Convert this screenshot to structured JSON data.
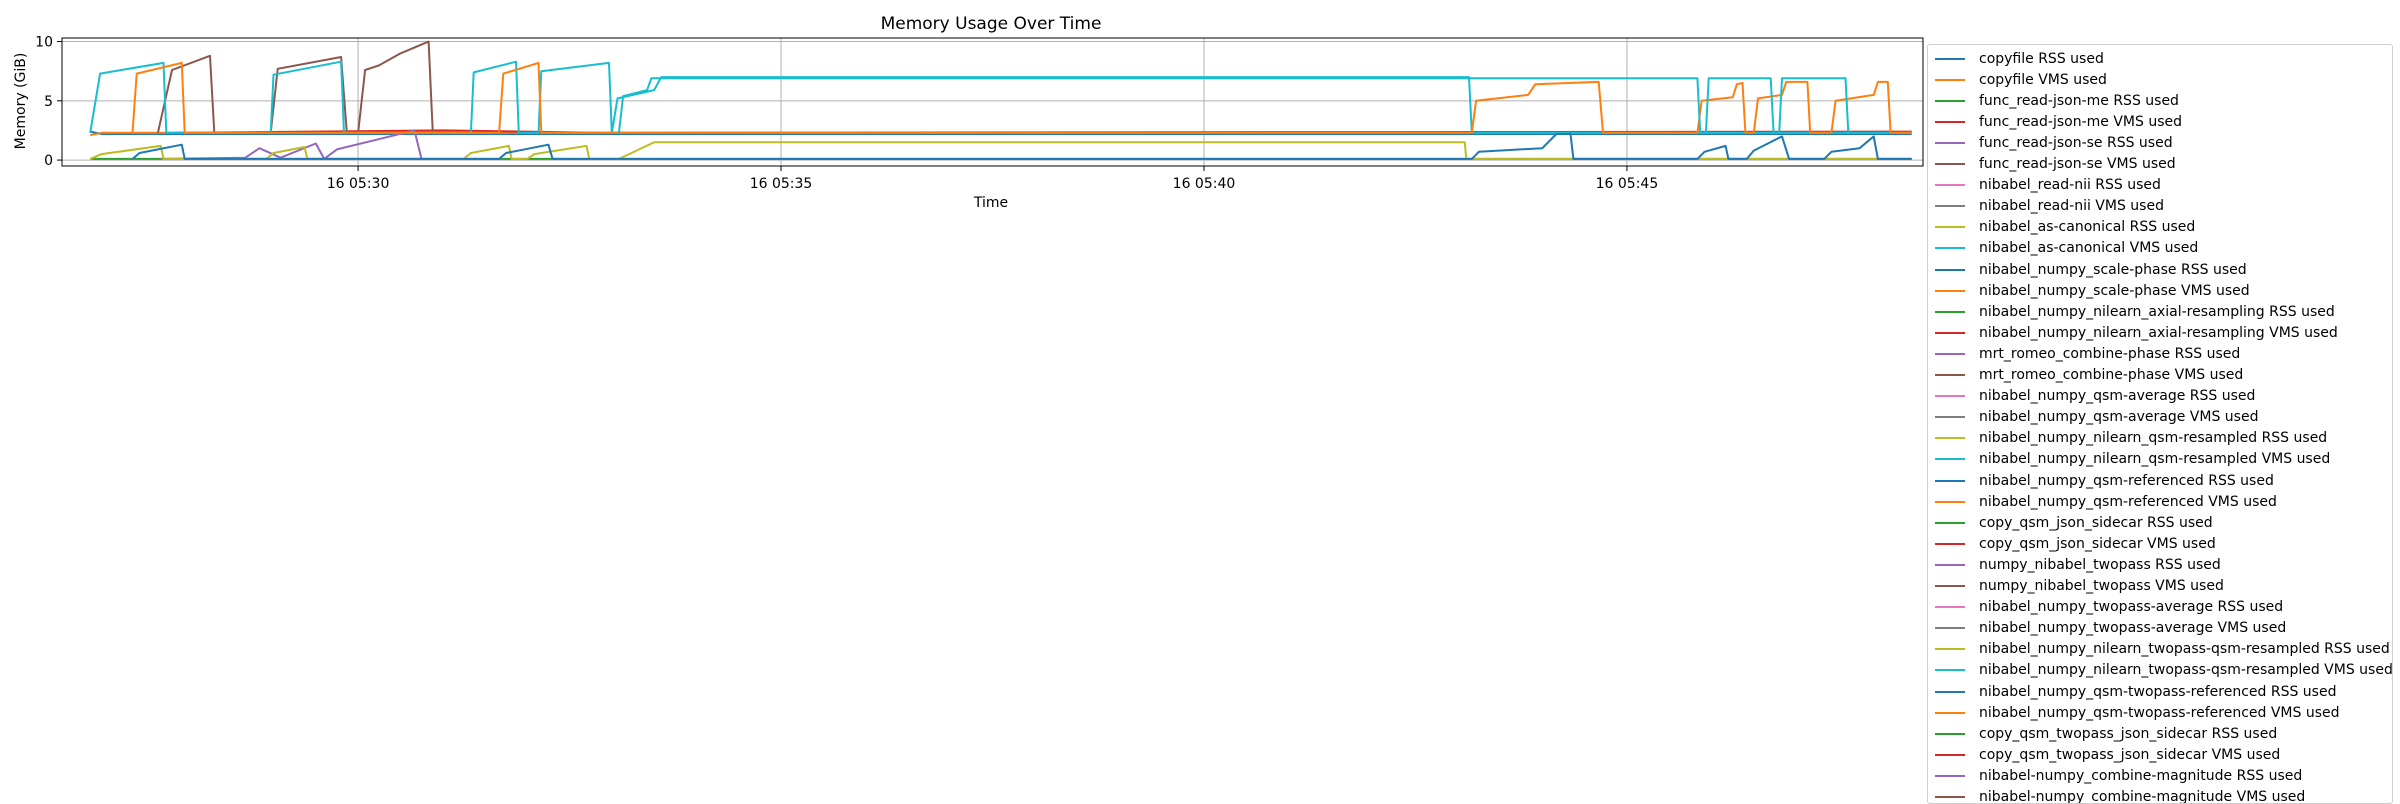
{
  "chart_data": {
    "type": "line",
    "title": "Memory Usage Over Time",
    "xlabel": "Time",
    "ylabel": "Memory (GiB)",
    "x_domain": [
      "16 05:26:30",
      "16 05:48:30"
    ],
    "ylim": [
      -0.5,
      10.3
    ],
    "x_ticks": [
      {
        "t": "16 05:30:00",
        "label": "16 05:30"
      },
      {
        "t": "16 05:35:00",
        "label": "16 05:35"
      },
      {
        "t": "16 05:40:00",
        "label": "16 05:40"
      },
      {
        "t": "16 05:45:00",
        "label": "16 05:45"
      }
    ],
    "y_ticks": [
      0,
      5,
      10
    ],
    "grid": true,
    "legend_position": "outside-right",
    "series": [
      {
        "name": "copyfile RSS used",
        "color": "#1f77b4",
        "points": [
          [
            "16 05:26:50",
            2.4
          ],
          [
            "16 05:26:58",
            2.2
          ],
          [
            "16 05:48:22",
            2.2
          ]
        ]
      },
      {
        "name": "copyfile VMS used",
        "color": "#ff7f0e",
        "points": [
          [
            "16 05:26:50",
            2.1
          ],
          [
            "16 05:26:58",
            2.3
          ],
          [
            "16 05:48:22",
            2.3
          ]
        ]
      },
      {
        "name": "func_read-json-me RSS used",
        "color": "#2ca02c",
        "points": [
          [
            "16 05:26:50",
            0.1
          ],
          [
            "16 05:48:22",
            0.1
          ]
        ]
      },
      {
        "name": "func_read-json-me VMS used",
        "color": "#d62728",
        "points": [
          [
            "16 05:27:50",
            2.3
          ],
          [
            "16 05:31:00",
            2.5
          ],
          [
            "16 05:32:50",
            2.3
          ],
          [
            "16 05:48:22",
            2.4
          ]
        ]
      },
      {
        "name": "func_read-json-se RSS used",
        "color": "#9467bd",
        "points": [
          [
            "16 05:27:40",
            0.1
          ],
          [
            "16 05:28:40",
            0.2
          ],
          [
            "16 05:28:50",
            1.0
          ],
          [
            "16 05:29:05",
            0.2
          ],
          [
            "16 05:29:30",
            1.4
          ],
          [
            "16 05:29:36",
            0.1
          ],
          [
            "16 05:29:45",
            0.9
          ],
          [
            "16 05:30:40",
            2.5
          ],
          [
            "16 05:30:45",
            0.1
          ]
        ]
      },
      {
        "name": "func_read-json-se VMS used",
        "color": "#8c564b",
        "points": [
          [
            "16 05:27:38",
            2.3
          ],
          [
            "16 05:27:48",
            7.6
          ],
          [
            "16 05:28:15",
            8.8
          ],
          [
            "16 05:28:18",
            2.3
          ],
          [
            "16 05:28:58",
            2.3
          ],
          [
            "16 05:29:03",
            7.7
          ],
          [
            "16 05:29:48",
            8.7
          ],
          [
            "16 05:29:52",
            2.3
          ],
          [
            "16 05:30:00",
            2.3
          ],
          [
            "16 05:30:05",
            7.6
          ],
          [
            "16 05:30:15",
            8.0
          ],
          [
            "16 05:30:30",
            9.0
          ],
          [
            "16 05:30:50",
            10.0
          ],
          [
            "16 05:30:53",
            2.3
          ]
        ]
      },
      {
        "name": "nibabel_read-nii RSS used",
        "color": "#e377c2",
        "points": []
      },
      {
        "name": "nibabel_read-nii VMS used",
        "color": "#7f7f7f",
        "points": []
      },
      {
        "name": "nibabel_as-canonical RSS used",
        "color": "#bcbd22",
        "points": [
          [
            "16 05:26:50",
            0.1
          ],
          [
            "16 05:26:58",
            0.5
          ],
          [
            "16 05:27:40",
            1.2
          ],
          [
            "16 05:27:42",
            0.1
          ],
          [
            "16 05:28:55",
            0.1
          ],
          [
            "16 05:29:00",
            0.6
          ],
          [
            "16 05:29:22",
            1.1
          ],
          [
            "16 05:29:24",
            0.1
          ],
          [
            "16 05:31:15",
            0.1
          ],
          [
            "16 05:31:20",
            0.6
          ],
          [
            "16 05:31:47",
            1.2
          ],
          [
            "16 05:31:49",
            0.1
          ],
          [
            "16 05:32:00",
            0.1
          ],
          [
            "16 05:32:05",
            0.5
          ],
          [
            "16 05:32:42",
            1.2
          ],
          [
            "16 05:32:44",
            0.1
          ],
          [
            "16 05:33:05",
            0.1
          ],
          [
            "16 05:33:30",
            1.5
          ],
          [
            "16 05:43:05",
            1.5
          ],
          [
            "16 05:43:06",
            0.1
          ],
          [
            "16 05:48:22",
            0.1
          ]
        ]
      },
      {
        "name": "nibabel_as-canonical VMS used",
        "color": "#17becf",
        "points": [
          [
            "16 05:26:50",
            2.3
          ],
          [
            "16 05:26:57",
            7.3
          ],
          [
            "16 05:27:42",
            8.2
          ],
          [
            "16 05:27:44",
            2.3
          ],
          [
            "16 05:28:58",
            2.3
          ],
          [
            "16 05:29:00",
            7.2
          ],
          [
            "16 05:29:48",
            8.3
          ],
          [
            "16 05:29:50",
            2.3
          ],
          [
            "16 05:31:20",
            2.3
          ],
          [
            "16 05:31:22",
            7.4
          ],
          [
            "16 05:31:52",
            8.3
          ],
          [
            "16 05:31:54",
            2.3
          ],
          [
            "16 05:32:08",
            2.3
          ],
          [
            "16 05:32:10",
            7.5
          ],
          [
            "16 05:32:58",
            8.2
          ],
          [
            "16 05:33:00",
            2.3
          ],
          [
            "16 05:33:04",
            5.2
          ],
          [
            "16 05:33:30",
            5.9
          ],
          [
            "16 05:33:35",
            7.0
          ],
          [
            "16 05:43:08",
            7.0
          ],
          [
            "16 05:43:10",
            2.3
          ],
          [
            "16 05:48:22",
            2.3
          ]
        ]
      },
      {
        "name": "nibabel_numpy_scale-phase RSS used",
        "color": "#1f77b4",
        "points": [
          [
            "16 05:27:20",
            0.1
          ],
          [
            "16 05:27:25",
            0.6
          ],
          [
            "16 05:27:55",
            1.3
          ],
          [
            "16 05:27:57",
            0.1
          ],
          [
            "16 05:31:40",
            0.1
          ],
          [
            "16 05:31:45",
            0.6
          ],
          [
            "16 05:32:15",
            1.3
          ],
          [
            "16 05:32:18",
            0.1
          ],
          [
            "16 05:43:10",
            0.1
          ],
          [
            "16 05:43:15",
            0.7
          ],
          [
            "16 05:44:00",
            1.0
          ],
          [
            "16 05:44:10",
            2.2
          ],
          [
            "16 05:44:20",
            2.2
          ],
          [
            "16 05:44:22",
            0.1
          ],
          [
            "16 05:45:50",
            0.1
          ],
          [
            "16 05:45:55",
            0.7
          ],
          [
            "16 05:46:10",
            1.2
          ],
          [
            "16 05:46:12",
            0.1
          ],
          [
            "16 05:46:25",
            0.1
          ],
          [
            "16 05:46:30",
            0.8
          ],
          [
            "16 05:46:50",
            2.0
          ],
          [
            "16 05:46:55",
            0.1
          ],
          [
            "16 05:47:20",
            0.1
          ],
          [
            "16 05:47:25",
            0.7
          ],
          [
            "16 05:47:45",
            1.0
          ],
          [
            "16 05:47:55",
            2.0
          ],
          [
            "16 05:47:58",
            0.1
          ],
          [
            "16 05:48:22",
            0.1
          ]
        ]
      },
      {
        "name": "nibabel_numpy_scale-phase VMS used",
        "color": "#ff7f0e",
        "points": [
          [
            "16 05:27:20",
            2.3
          ],
          [
            "16 05:27:23",
            7.3
          ],
          [
            "16 05:27:55",
            8.2
          ],
          [
            "16 05:27:57",
            2.3
          ],
          [
            "16 05:31:40",
            2.3
          ],
          [
            "16 05:31:43",
            7.3
          ],
          [
            "16 05:32:08",
            8.2
          ],
          [
            "16 05:32:10",
            2.3
          ],
          [
            "16 05:43:10",
            2.3
          ],
          [
            "16 05:43:13",
            5.0
          ],
          [
            "16 05:43:50",
            5.5
          ],
          [
            "16 05:43:55",
            6.4
          ],
          [
            "16 05:44:40",
            6.6
          ],
          [
            "16 05:44:43",
            2.3
          ],
          [
            "16 05:45:50",
            2.3
          ],
          [
            "16 05:45:53",
            5.0
          ],
          [
            "16 05:46:15",
            5.3
          ],
          [
            "16 05:46:18",
            6.4
          ],
          [
            "16 05:46:22",
            6.5
          ],
          [
            "16 05:46:24",
            2.3
          ],
          [
            "16 05:46:30",
            2.3
          ],
          [
            "16 05:46:33",
            5.2
          ],
          [
            "16 05:46:50",
            5.5
          ],
          [
            "16 05:46:53",
            6.6
          ],
          [
            "16 05:47:08",
            6.6
          ],
          [
            "16 05:47:10",
            2.3
          ],
          [
            "16 05:47:25",
            2.3
          ],
          [
            "16 05:47:28",
            5.0
          ],
          [
            "16 05:47:55",
            5.5
          ],
          [
            "16 05:47:58",
            6.6
          ],
          [
            "16 05:48:05",
            6.6
          ],
          [
            "16 05:48:07",
            2.3
          ],
          [
            "16 05:48:22",
            2.3
          ]
        ]
      },
      {
        "name": "nibabel_numpy_nilearn_axial-resampling RSS used",
        "color": "#2ca02c",
        "points": []
      },
      {
        "name": "nibabel_numpy_nilearn_axial-resampling VMS used",
        "color": "#d62728",
        "points": []
      },
      {
        "name": "mrt_romeo_combine-phase RSS used",
        "color": "#9467bd",
        "points": []
      },
      {
        "name": "mrt_romeo_combine-phase VMS used",
        "color": "#8c564b",
        "points": []
      },
      {
        "name": "nibabel_numpy_qsm-average RSS used",
        "color": "#e377c2",
        "points": []
      },
      {
        "name": "nibabel_numpy_qsm-average VMS used",
        "color": "#7f7f7f",
        "points": []
      },
      {
        "name": "nibabel_numpy_nilearn_qsm-resampled RSS used",
        "color": "#bcbd22",
        "points": []
      },
      {
        "name": "nibabel_numpy_nilearn_qsm-resampled VMS used",
        "color": "#17becf",
        "points": [
          [
            "16 05:33:05",
            2.3
          ],
          [
            "16 05:33:08",
            5.4
          ],
          [
            "16 05:33:25",
            5.9
          ],
          [
            "16 05:33:28",
            6.9
          ],
          [
            "16 05:45:50",
            6.9
          ],
          [
            "16 05:45:52",
            2.3
          ],
          [
            "16 05:45:56",
            2.3
          ],
          [
            "16 05:45:58",
            6.9
          ],
          [
            "16 05:46:42",
            6.9
          ],
          [
            "16 05:46:44",
            2.3
          ],
          [
            "16 05:46:48",
            2.3
          ],
          [
            "16 05:46:50",
            6.9
          ],
          [
            "16 05:47:35",
            6.9
          ],
          [
            "16 05:47:37",
            2.3
          ]
        ]
      },
      {
        "name": "nibabel_numpy_qsm-referenced RSS used",
        "color": "#1f77b4",
        "points": []
      },
      {
        "name": "nibabel_numpy_qsm-referenced VMS used",
        "color": "#ff7f0e",
        "points": []
      },
      {
        "name": "copy_qsm_json_sidecar RSS used",
        "color": "#2ca02c",
        "points": []
      },
      {
        "name": "copy_qsm_json_sidecar VMS used",
        "color": "#d62728",
        "points": []
      },
      {
        "name": "numpy_nibabel_twopass RSS used",
        "color": "#9467bd",
        "points": []
      },
      {
        "name": "numpy_nibabel_twopass VMS used",
        "color": "#8c564b",
        "points": []
      },
      {
        "name": "nibabel_numpy_twopass-average RSS used",
        "color": "#e377c2",
        "points": []
      },
      {
        "name": "nibabel_numpy_twopass-average VMS used",
        "color": "#7f7f7f",
        "points": []
      },
      {
        "name": "nibabel_numpy_nilearn_twopass-qsm-resampled RSS used",
        "color": "#bcbd22",
        "points": []
      },
      {
        "name": "nibabel_numpy_nilearn_twopass-qsm-resampled VMS used",
        "color": "#17becf",
        "points": []
      },
      {
        "name": "nibabel_numpy_qsm-twopass-referenced RSS used",
        "color": "#1f77b4",
        "points": []
      },
      {
        "name": "nibabel_numpy_qsm-twopass-referenced VMS used",
        "color": "#ff7f0e",
        "points": []
      },
      {
        "name": "copy_qsm_twopass_json_sidecar RSS used",
        "color": "#2ca02c",
        "points": []
      },
      {
        "name": "copy_qsm_twopass_json_sidecar VMS used",
        "color": "#d62728",
        "points": []
      },
      {
        "name": "nibabel-numpy_combine-magnitude RSS used",
        "color": "#9467bd",
        "points": []
      },
      {
        "name": "nibabel-numpy_combine-magnitude VMS used",
        "color": "#8c564b",
        "points": []
      }
    ]
  }
}
